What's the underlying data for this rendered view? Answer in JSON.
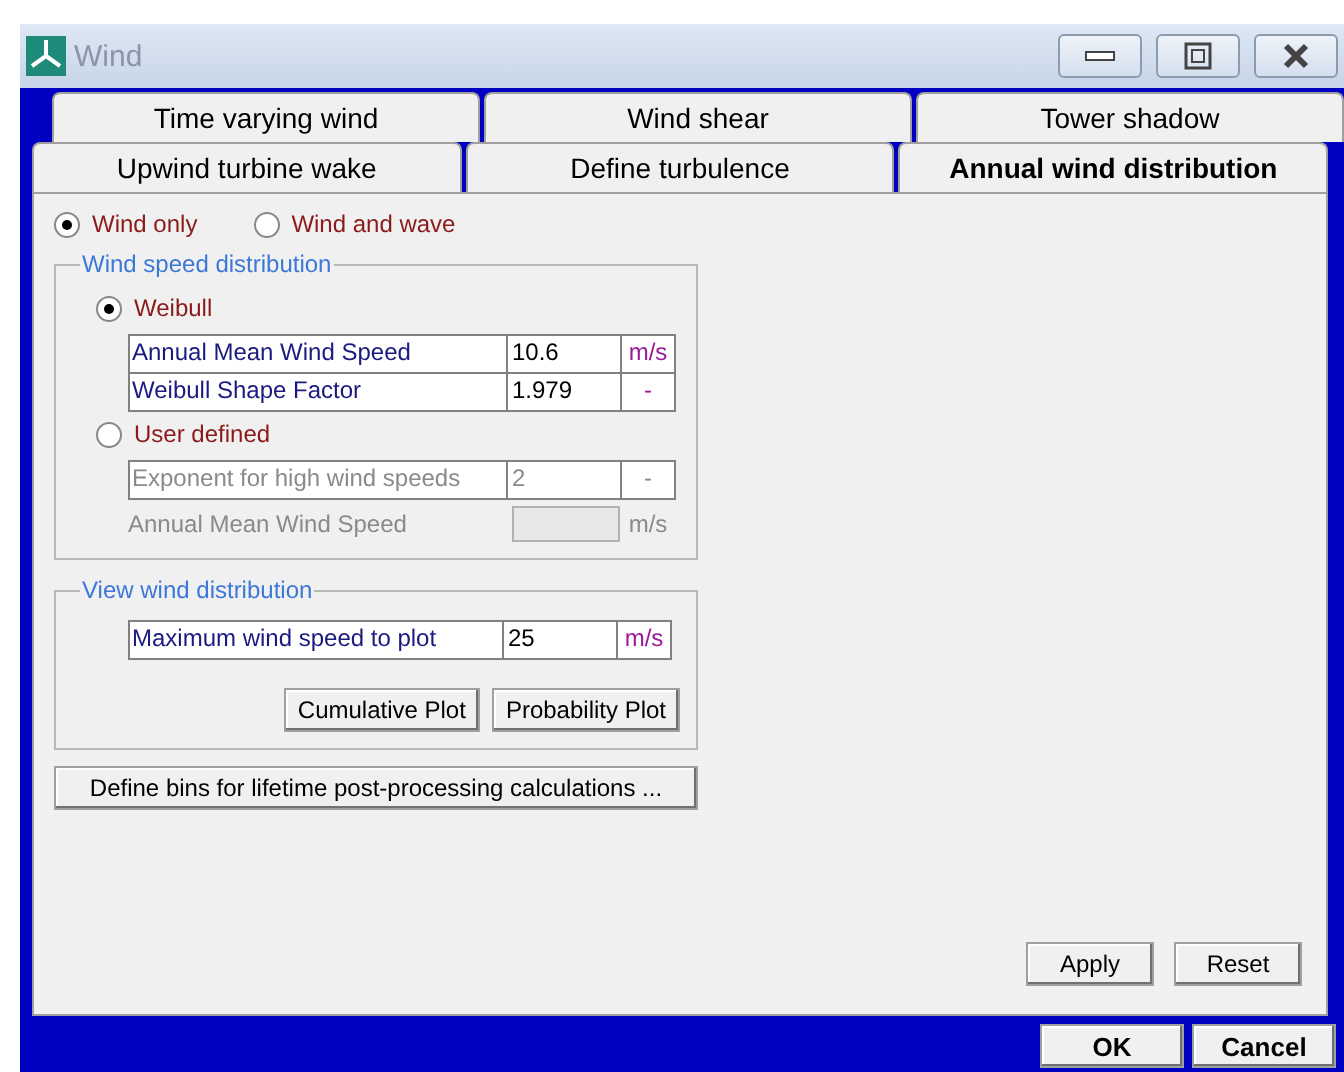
{
  "window": {
    "title": "Wind"
  },
  "tab_rows": [
    [
      {
        "label": "Time varying wind",
        "selected": false
      },
      {
        "label": "Wind shear",
        "selected": false
      },
      {
        "label": "Tower shadow",
        "selected": false
      }
    ],
    [
      {
        "label": "Upwind turbine wake",
        "selected": false
      },
      {
        "label": "Define turbulence",
        "selected": false
      },
      {
        "label": "Annual wind distribution",
        "selected": true
      }
    ]
  ],
  "mode": [
    {
      "label": "Wind only",
      "selected": true
    },
    {
      "label": "Wind and wave",
      "selected": false
    }
  ],
  "distribution": {
    "title": "Wind speed distribution",
    "options": [
      {
        "label": "Weibull",
        "selected": true,
        "rows": [
          {
            "kind": "table",
            "label": "Annual Mean Wind Speed",
            "value": "10.6",
            "unit": "m/s"
          },
          {
            "kind": "table",
            "label": "Weibull Shape Factor",
            "value": "1.979",
            "unit": "-"
          }
        ]
      },
      {
        "label": "User defined",
        "selected": false,
        "rows": [
          {
            "kind": "table",
            "label": "Exponent for high wind speeds",
            "value": "2",
            "unit": "-"
          },
          {
            "kind": "plain",
            "label": "Annual Mean Wind Speed",
            "unit": "m/s"
          }
        ]
      }
    ]
  },
  "view": {
    "title": "View wind distribution",
    "field": {
      "label": "Maximum wind speed to plot",
      "value": "25",
      "unit": "m/s"
    },
    "buttons": [
      "Cumulative Plot",
      "Probability Plot"
    ]
  },
  "bins_button": "Define bins for lifetime post-processing calculations ...",
  "panel_buttons": [
    "Apply",
    "Reset"
  ],
  "dialog_buttons": [
    "OK",
    "Cancel"
  ]
}
